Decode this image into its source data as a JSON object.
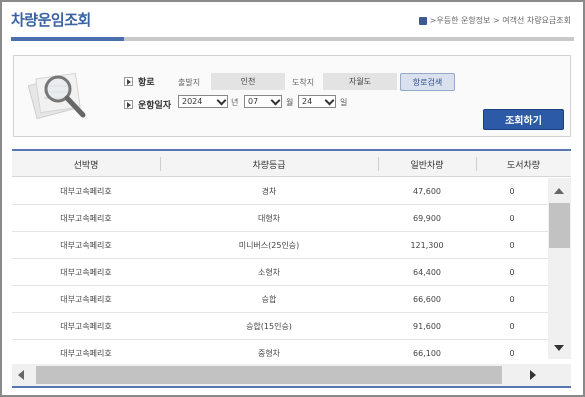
{
  "page": {
    "title": "차량운임조회",
    "breadcrumb": ">우등한 운항정보 > 여객선 차량요금조회"
  },
  "search": {
    "route_label": "항로",
    "departure_label": "출발지",
    "departure_value": "인천",
    "arrival_label": "도착지",
    "arrival_value": "자월도",
    "route_search_button": "항로검색",
    "date_label": "운항일자",
    "year": "2024",
    "year_unit": "년",
    "month": "07",
    "month_unit": "월",
    "day": "24",
    "day_unit": "일",
    "query_button": "조회하기"
  },
  "table": {
    "headers": [
      "선박명",
      "차량등급",
      "일반차량",
      "도서차량"
    ],
    "rows": [
      [
        "대부고속페리호",
        "경차",
        "47,600",
        "0"
      ],
      [
        "대부고속페리호",
        "대형차",
        "69,900",
        "0"
      ],
      [
        "대부고속페리호",
        "미니버스(25인승)",
        "121,300",
        "0"
      ],
      [
        "대부고속페리호",
        "소형차",
        "64,400",
        "0"
      ],
      [
        "대부고속페리호",
        "승합",
        "66,600",
        "0"
      ],
      [
        "대부고속페리호",
        "승합(15인승)",
        "91,600",
        "0"
      ],
      [
        "대부고속페리호",
        "중형차",
        "66,100",
        "0"
      ]
    ]
  },
  "colors": {
    "accent": "#3a63a3",
    "button_primary": "#2d5aa6"
  },
  "icons": {
    "search_illustration": "magnifier-icon",
    "home": "home-icon"
  }
}
